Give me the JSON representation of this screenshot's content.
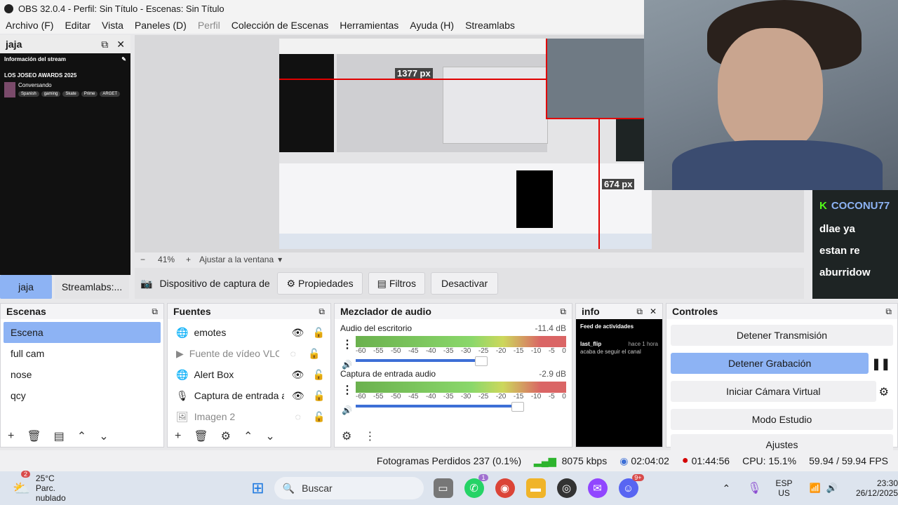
{
  "window": {
    "title": "OBS 32.0.4 - Perfil: Sin Título - Escenas: Sin Título"
  },
  "menu": [
    "Archivo (F)",
    "Editar",
    "Vista",
    "Paneles (D)",
    "Perfil",
    "Colección de Escenas",
    "Herramientas",
    "Ayuda (H)",
    "Streamlabs"
  ],
  "left_dock": {
    "title": "jaja",
    "stream_info_label": "Información del stream",
    "stream_title": "LOS JOSEO AWARDS 2025",
    "category": "Conversando",
    "tags": [
      "Spanish",
      "gaming",
      "Skate",
      "Prime",
      "ARGET"
    ],
    "tabs": [
      "jaja",
      "Streamlabs:..."
    ]
  },
  "nested_preview": {
    "label_1377": "1377 px",
    "label_674": "674 px"
  },
  "zoom": {
    "minus": "−",
    "value": "41%",
    "plus": "+",
    "fit_label": "Ajustar a la ventana"
  },
  "source_toolbar": {
    "device": "Dispositivo de captura de v",
    "properties": "Propiedades",
    "filters": "Filtros",
    "deactivate": "Desactivar"
  },
  "webcam_chat": {
    "username": "COCONU77",
    "lines": [
      "dlae ya",
      "estan re",
      "aburridow"
    ]
  },
  "scenes": {
    "title": "Escenas",
    "items": [
      "Escena",
      "full cam",
      "nose",
      "qcy"
    ],
    "selected": "Escena"
  },
  "sources": {
    "title": "Fuentes",
    "items": [
      {
        "name": "emotes",
        "icon": "globe-icon",
        "visible": true
      },
      {
        "name": "Fuente de vídeo VLC",
        "icon": "play-icon",
        "visible": false
      },
      {
        "name": "Alert Box",
        "icon": "globe-icon",
        "visible": true
      },
      {
        "name": "Captura de entrada a",
        "icon": "microphone-icon",
        "visible": true
      },
      {
        "name": "Imagen 2",
        "icon": "image-icon",
        "visible": false
      }
    ]
  },
  "mixer": {
    "title": "Mezclador de audio",
    "tracks": [
      {
        "name": "Audio del escritorio",
        "db": "-11.4 dB",
        "volume_fraction": 0.9
      },
      {
        "name": "Captura de entrada audio",
        "db": "-2.9 dB",
        "volume_fraction": 0.95
      }
    ],
    "scale": [
      "-60",
      "-55",
      "-50",
      "-45",
      "-40",
      "-35",
      "-30",
      "-25",
      "-20",
      "-15",
      "-10",
      "-5",
      "0"
    ]
  },
  "info": {
    "title": "info",
    "feed_title": "Feed de actividades",
    "user": "last_flip",
    "time": "hace 1 hora",
    "action": "acaba de seguir el canal"
  },
  "controls": {
    "title": "Controles",
    "buttons": [
      "Detener Transmisión",
      "Detener Grabación",
      "Iniciar Cámara Virtual",
      "Modo Estudio",
      "Ajustes"
    ]
  },
  "status": {
    "dropped": "Fotogramas Perdidos 237 (0.1%)",
    "bitrate": "8075 kbps",
    "stream_time": "02:04:02",
    "rec_time": "01:44:56",
    "cpu": "CPU: 15.1%",
    "fps": "59.94 / 59.94 FPS"
  },
  "taskbar": {
    "weather_temp": "25°C",
    "weather_desc": "Parc. nublado",
    "weather_badge": "2",
    "search": "Buscar",
    "lang": "ESP",
    "region": "US",
    "time": "23:30",
    "date": "26/12/2025",
    "whatsapp_badge": "1",
    "discord_badge": "9+"
  },
  "colors": {
    "accent": "#8db3f4",
    "rec_red": "#d40000",
    "chat_green": "#53fc18"
  }
}
